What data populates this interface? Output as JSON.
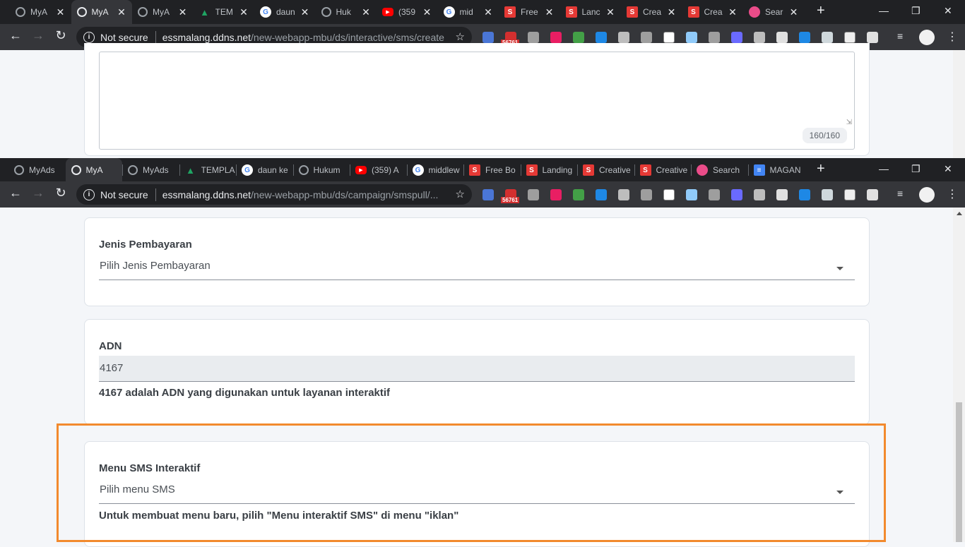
{
  "browser_top": {
    "tabs": [
      {
        "title": "MyA",
        "fav": "globe-icon",
        "color": "#5f6368"
      },
      {
        "title": "MyA",
        "fav": "globe-icon",
        "color": "#5f6368",
        "active": true
      },
      {
        "title": "MyA",
        "fav": "globe-icon",
        "color": "#5f6368"
      },
      {
        "title": "TEM",
        "fav": "drive-icon",
        "color": "#1fa463"
      },
      {
        "title": "daun",
        "fav": "google-icon",
        "color": "#4285f4"
      },
      {
        "title": "Huk",
        "fav": "globe-icon",
        "color": "#5f6368"
      },
      {
        "title": "(359",
        "fav": "youtube-icon",
        "color": "#ff0000"
      },
      {
        "title": "mid",
        "fav": "google-icon",
        "color": "#4285f4"
      },
      {
        "title": "Free",
        "fav": "s-icon",
        "color": "#e53935"
      },
      {
        "title": "Lanc",
        "fav": "s-icon",
        "color": "#e53935"
      },
      {
        "title": "Crea",
        "fav": "s-icon",
        "color": "#e53935"
      },
      {
        "title": "Crea",
        "fav": "s-icon",
        "color": "#e53935"
      },
      {
        "title": "Sear",
        "fav": "dribbble-icon",
        "color": "#ea4c89"
      }
    ],
    "omnibox": {
      "security": "Not secure",
      "host": "essmalang.ddns.net",
      "path": "/new-webapp-mbu/ds/interactive/sms/create"
    }
  },
  "browser_bottom": {
    "tabs": [
      {
        "title": "MyAds",
        "fav": "globe-icon",
        "color": "#5f6368"
      },
      {
        "title": "MyA",
        "fav": "globe-icon",
        "color": "#5f6368",
        "active": true
      },
      {
        "title": "MyAds",
        "fav": "globe-icon",
        "color": "#5f6368"
      },
      {
        "title": "TEMPLA",
        "fav": "drive-icon",
        "color": "#1fa463"
      },
      {
        "title": "daun ke",
        "fav": "google-icon",
        "color": "#4285f4"
      },
      {
        "title": "Hukum",
        "fav": "globe-icon",
        "color": "#5f6368"
      },
      {
        "title": "(359) A",
        "fav": "youtube-icon",
        "color": "#ff0000"
      },
      {
        "title": "middlew",
        "fav": "google-icon",
        "color": "#4285f4"
      },
      {
        "title": "Free Bo",
        "fav": "s-icon",
        "color": "#e53935"
      },
      {
        "title": "Landing",
        "fav": "s-icon",
        "color": "#e53935"
      },
      {
        "title": "Creative",
        "fav": "s-icon",
        "color": "#e53935"
      },
      {
        "title": "Creative",
        "fav": "s-icon",
        "color": "#e53935"
      },
      {
        "title": "Search",
        "fav": "dribbble-icon",
        "color": "#ea4c89"
      },
      {
        "title": "MAGAN",
        "fav": "docs-icon",
        "color": "#4285f4"
      }
    ],
    "omnibox": {
      "security": "Not secure",
      "host": "essmalang.ddns.net",
      "path": "/new-webapp-mbu/ds/campaign/smspull/..."
    }
  },
  "extensions": {
    "badge": "56761"
  },
  "top_page": {
    "counter": "160/160"
  },
  "form": {
    "payment": {
      "label": "Jenis Pembayaran",
      "placeholder": "Pilih Jenis Pembayaran"
    },
    "adn": {
      "label": "ADN",
      "value": "4167",
      "helper": "4167 adalah ADN yang digunakan untuk layanan interaktif"
    },
    "menu": {
      "label": "Menu SMS Interaktif",
      "placeholder": "Pilih menu SMS",
      "helper": "Untuk membuat menu baru, pilih \"Menu interaktif SMS\" di menu \"iklan\""
    }
  },
  "colors": {
    "highlight": "#f28a2e",
    "chrome_dark": "#202124",
    "chrome_toolbar": "#35363a"
  }
}
